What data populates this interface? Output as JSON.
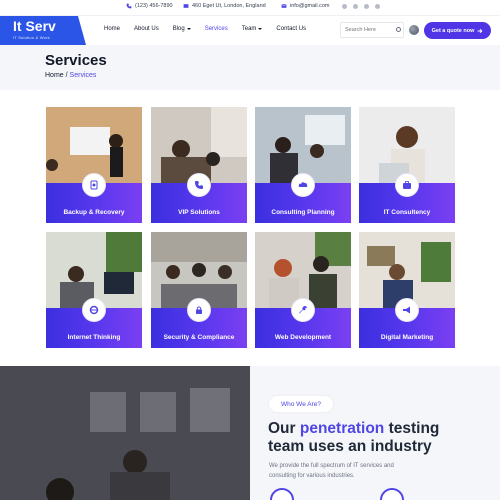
{
  "topbar": {
    "phone": "(123) 456-7890",
    "address": "460 Eget Ut, London, England",
    "email": "info@gmail.com",
    "social_icons": [
      "facebook-icon",
      "instagram-icon",
      "linkedin-icon",
      "globe-icon"
    ]
  },
  "brand": {
    "title": "It Serv",
    "subtitle": "IT Solution & Work",
    "color": "#2b55e6"
  },
  "nav": {
    "home": "Home",
    "about": "About Us",
    "blog": "Blog",
    "services": "Services",
    "team": "Team",
    "contact": "Contact Us"
  },
  "search": {
    "placeholder": "Search Here"
  },
  "cta": {
    "label": "Get a quote now"
  },
  "page": {
    "title": "Services",
    "breadcrumb_home": "Home",
    "breadcrumb_sep": "/",
    "breadcrumb_current": "Services"
  },
  "services": [
    {
      "label": "Backup & Recovery",
      "icon": "backup-icon"
    },
    {
      "label": "VIP Solutions",
      "icon": "phone-icon"
    },
    {
      "label": "Consulting Planning",
      "icon": "cloud-icon"
    },
    {
      "label": "IT Consultency",
      "icon": "briefcase-icon"
    },
    {
      "label": "Internet Thinking",
      "icon": "internet-explorer-icon"
    },
    {
      "label": "Security & Compliance",
      "icon": "lock-icon"
    },
    {
      "label": "Web Development",
      "icon": "wrench-icon"
    },
    {
      "label": "Digital Marketing",
      "icon": "megaphone-icon"
    }
  ],
  "about": {
    "badge": "Who We Are?",
    "headline_pre": "Our ",
    "headline_accent": "penetration",
    "headline_post": " testing team uses an industry",
    "description": "We provide the full spectrum of IT services and consulting for various industries."
  },
  "colors": {
    "accent": "#4f46e5",
    "card_gradient_start": "#3b2fe0",
    "card_gradient_end": "#7b3ff2",
    "band_bg": "#f5f6fa"
  }
}
